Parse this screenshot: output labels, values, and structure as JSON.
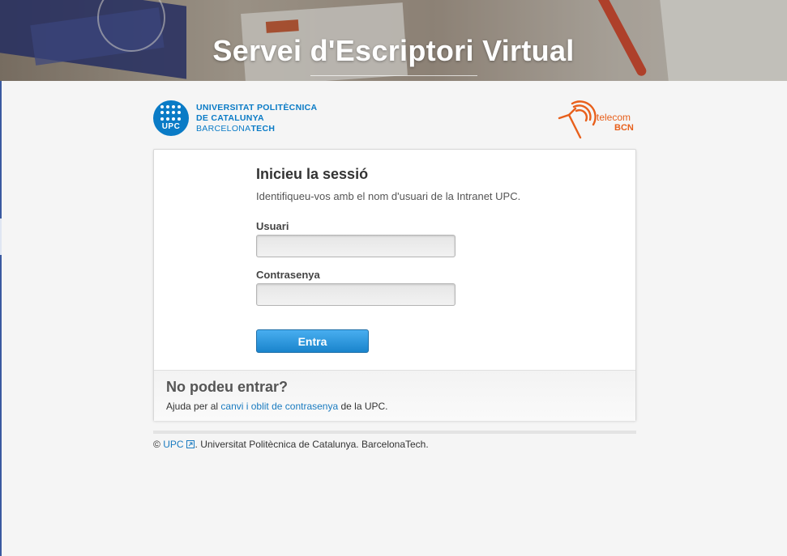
{
  "banner": {
    "title": "Servei d'Escriptori Virtual"
  },
  "upc_logo": {
    "emblem_text": "UPC",
    "line1": "UNIVERSITAT POLITÈCNICA",
    "line2": "DE CATALUNYA",
    "line3_regular": "BARCELONA",
    "line3_bold": "TECH"
  },
  "telecom_logo": {
    "line1": "telecom",
    "line2": "BCN"
  },
  "login": {
    "title": "Inicieu la sessió",
    "subtitle": "Identifiqueu-vos amb el nom d'usuari de la Intranet UPC.",
    "user_label": "Usuari",
    "user_value": "",
    "password_label": "Contrasenya",
    "password_value": "",
    "submit_label": "Entra"
  },
  "help": {
    "title": "No podeu entrar?",
    "text_before": "Ajuda per al ",
    "link_text": "canvi i oblit de contrasenya",
    "text_after": " de la UPC."
  },
  "footer": {
    "copyright": "©",
    "link_text": "UPC",
    "link_icon": "external-link-icon",
    "text": ". Universitat Politècnica de Catalunya. BarcelonaTech."
  },
  "colors": {
    "brand_blue": "#0a7bc6",
    "telecom_orange": "#e8601c",
    "button_blue": "#1a84cc",
    "link_blue": "#1a7bc0"
  }
}
